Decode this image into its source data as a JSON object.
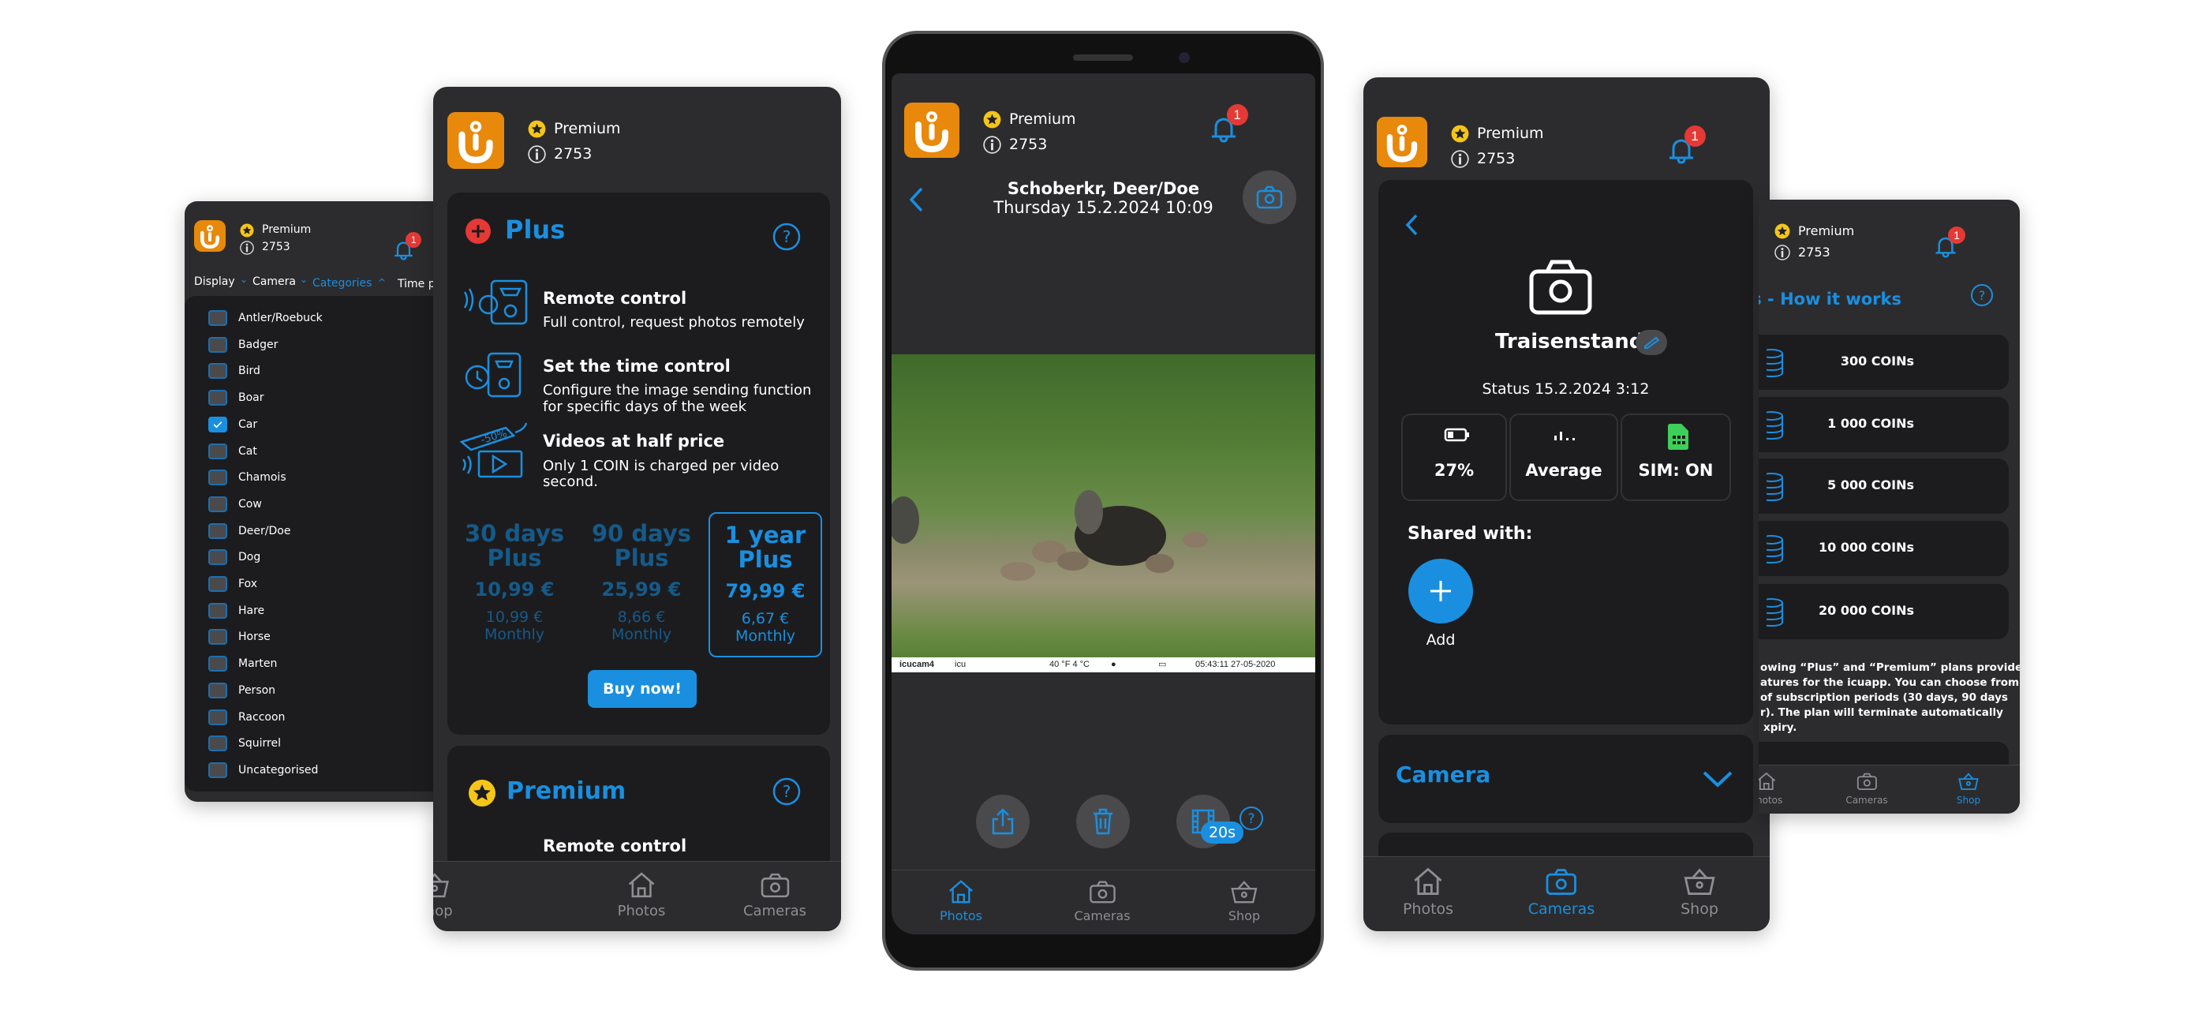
{
  "header": {
    "plan": "Premium",
    "coins": "2753",
    "notifications": "1"
  },
  "colors": {
    "accent": "#1a8fe0",
    "brand": "#e8890c",
    "badge": "#e53935",
    "star": "#f5c518",
    "sim": "#3ecf5a"
  },
  "nav": {
    "photos": "Photos",
    "cameras": "Cameras",
    "shop": "Shop"
  },
  "filter_screen": {
    "tabs": [
      {
        "label": "Display"
      },
      {
        "label": "Camera"
      },
      {
        "label": "Categories"
      },
      {
        "label": "Time pe"
      }
    ],
    "categories": [
      {
        "label": "Antler/Roebuck",
        "checked": false
      },
      {
        "label": "Badger",
        "checked": false
      },
      {
        "label": "Bird",
        "checked": false
      },
      {
        "label": "Boar",
        "checked": false
      },
      {
        "label": "Car",
        "checked": true
      },
      {
        "label": "Cat",
        "checked": false
      },
      {
        "label": "Chamois",
        "checked": false
      },
      {
        "label": "Cow",
        "checked": false
      },
      {
        "label": "Deer/Doe",
        "checked": false
      },
      {
        "label": "Dog",
        "checked": false
      },
      {
        "label": "Fox",
        "checked": false
      },
      {
        "label": "Hare",
        "checked": false
      },
      {
        "label": "Horse",
        "checked": false
      },
      {
        "label": "Marten",
        "checked": false
      },
      {
        "label": "Person",
        "checked": false
      },
      {
        "label": "Raccoon",
        "checked": false
      },
      {
        "label": "Squirrel",
        "checked": false
      },
      {
        "label": "Uncategorised",
        "checked": false
      }
    ]
  },
  "shop_plans": {
    "plus_title": "Plus",
    "features": [
      {
        "title": "Remote control",
        "desc1": "Full control, request photos remotely",
        "desc2": ""
      },
      {
        "title": "Set the time control",
        "desc1": "Configure the image sending function",
        "desc2": "for specific days of the week"
      },
      {
        "title": "Videos at half price",
        "desc1": "Only 1 COIN is charged per video",
        "desc2": "second."
      }
    ],
    "discount_tag": "-50%",
    "plans": [
      {
        "line1": "30 days",
        "line2": "Plus",
        "price": "10,99 €",
        "monthly": "10,99 €",
        "monthly_label": "Monthly",
        "selected": false
      },
      {
        "line1": "90 days",
        "line2": "Plus",
        "price": "25,99 €",
        "monthly": "8,66 €",
        "monthly_label": "Monthly",
        "selected": false
      },
      {
        "line1": "1 year",
        "line2": "Plus",
        "price": "79,99 €",
        "monthly": "6,67 €",
        "monthly_label": "Monthly",
        "selected": true
      }
    ],
    "buy_label": "Buy now!",
    "premium_title": "Premium",
    "premium_feature": "Remote control"
  },
  "photo_view": {
    "title": "Schoberkr, Deer/Doe",
    "datetime": "Thursday 15.2.2024 10:09",
    "overlay": {
      "brand": "icucam4",
      "name": "icu",
      "temp": "40 °F  4 °C",
      "time": "05:43:11  27-05-2020"
    },
    "video_length": "20s"
  },
  "camera_detail": {
    "name": "Traisenstand",
    "status": "Status 15.2.2024 3:12",
    "battery": "27%",
    "signal": "Average",
    "sim": "SIM: ON",
    "shared_label": "Shared with:",
    "add_label": "Add",
    "section": "Camera"
  },
  "coins_shop": {
    "title": "s - How it works",
    "packages": [
      "300 COINs",
      "1 000 COINs",
      "5 000 COINs",
      "10 000 COINs",
      "20 000 COINs"
    ],
    "info_lines": [
      "owing “Plus” and “Premium” plans provide",
      "atures for the icuapp. You can choose from",
      "of subscription periods (30 days, 90 days",
      "r). The plan will terminate automatically",
      "xpiry."
    ]
  }
}
